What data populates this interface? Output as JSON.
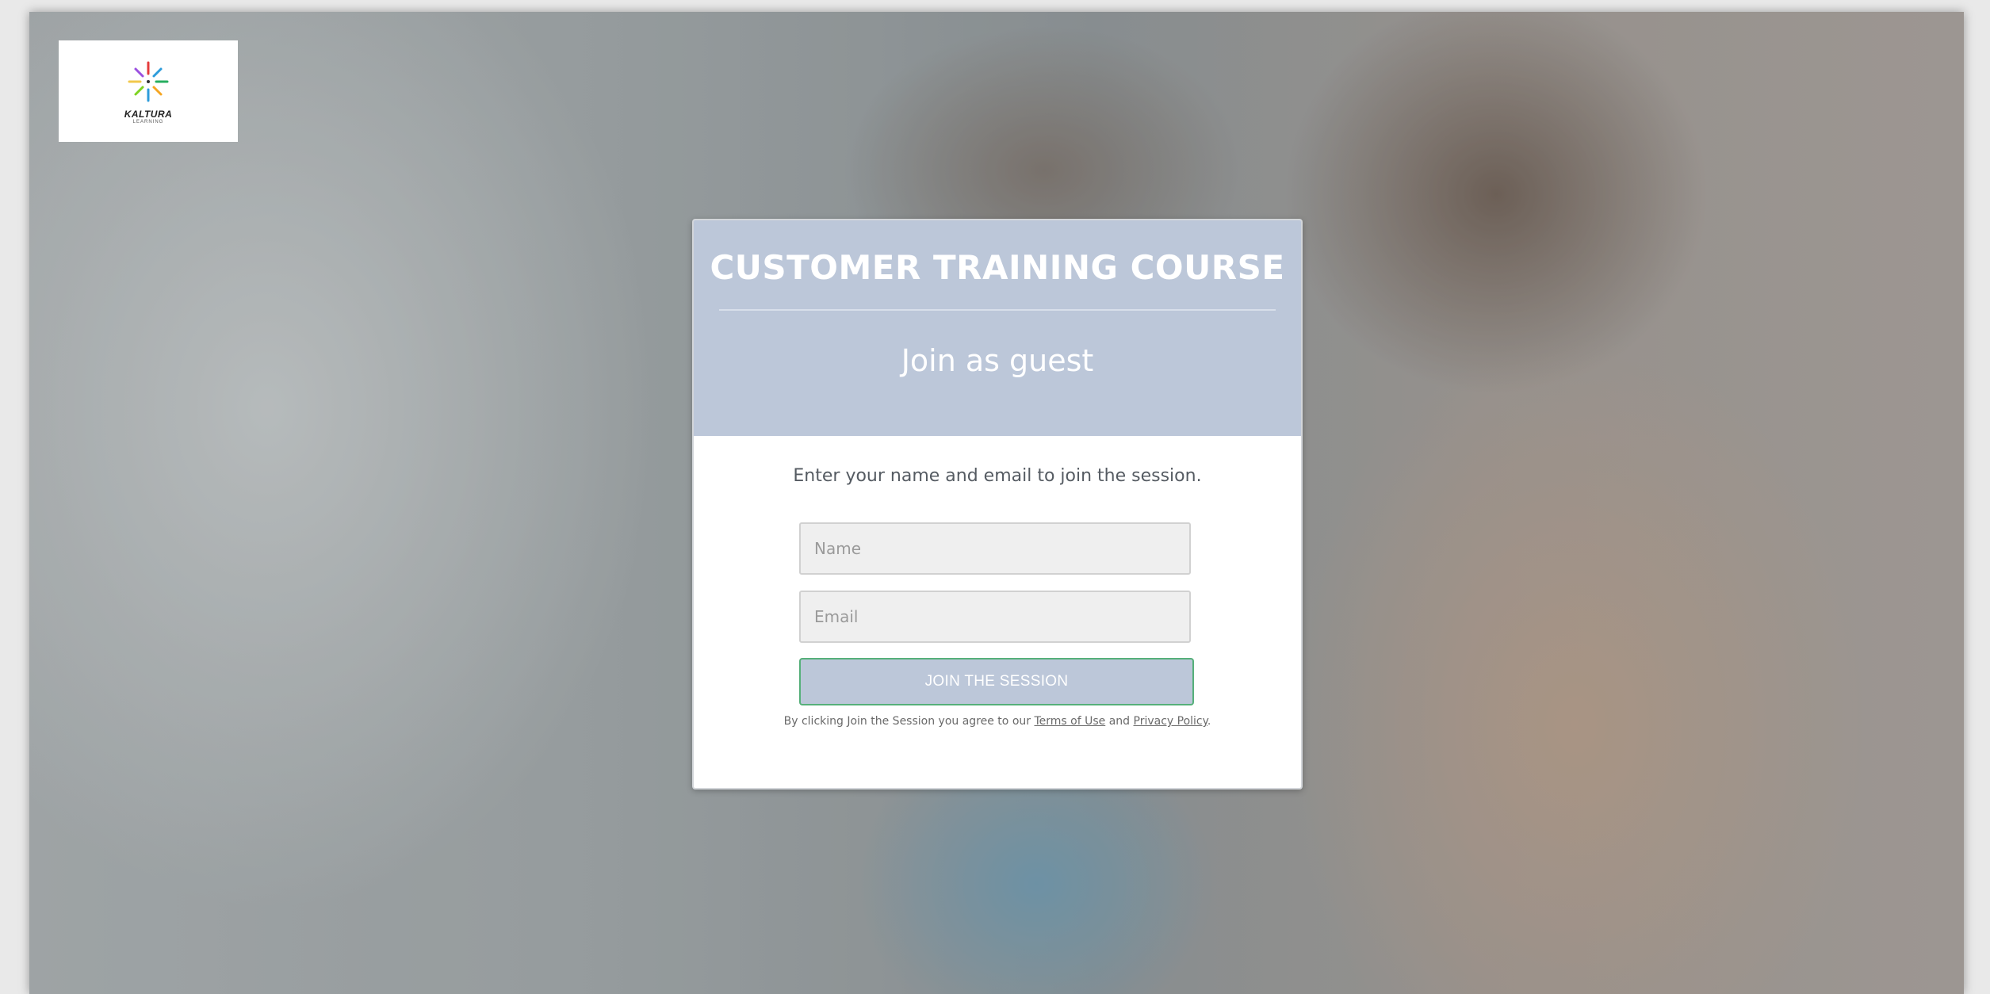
{
  "brand": {
    "name": "KALTURA",
    "sub": "LEARNING",
    "logo_colors": [
      "#e43c3c",
      "#f5a623",
      "#7ed321",
      "#2d9cdb",
      "#9b51e0",
      "#f2c94c",
      "#27ae60",
      "#eb5757"
    ]
  },
  "card": {
    "course_title": "CUSTOMER TRAINING COURSE",
    "join_heading": "Join as guest",
    "instructions": "Enter your name and email to join the session.",
    "name_placeholder": "Name",
    "email_placeholder": "Email",
    "join_button_label": "JOIN THE SESSION",
    "agreement": {
      "prefix": "By clicking Join the Session you agree to our",
      "terms_link": "Terms of Use",
      "conjunction": "and",
      "privacy_link": "Privacy Policy",
      "suffix": "."
    }
  },
  "colors": {
    "header_bg": "#bcc7d9",
    "button_border": "#56b07a"
  }
}
